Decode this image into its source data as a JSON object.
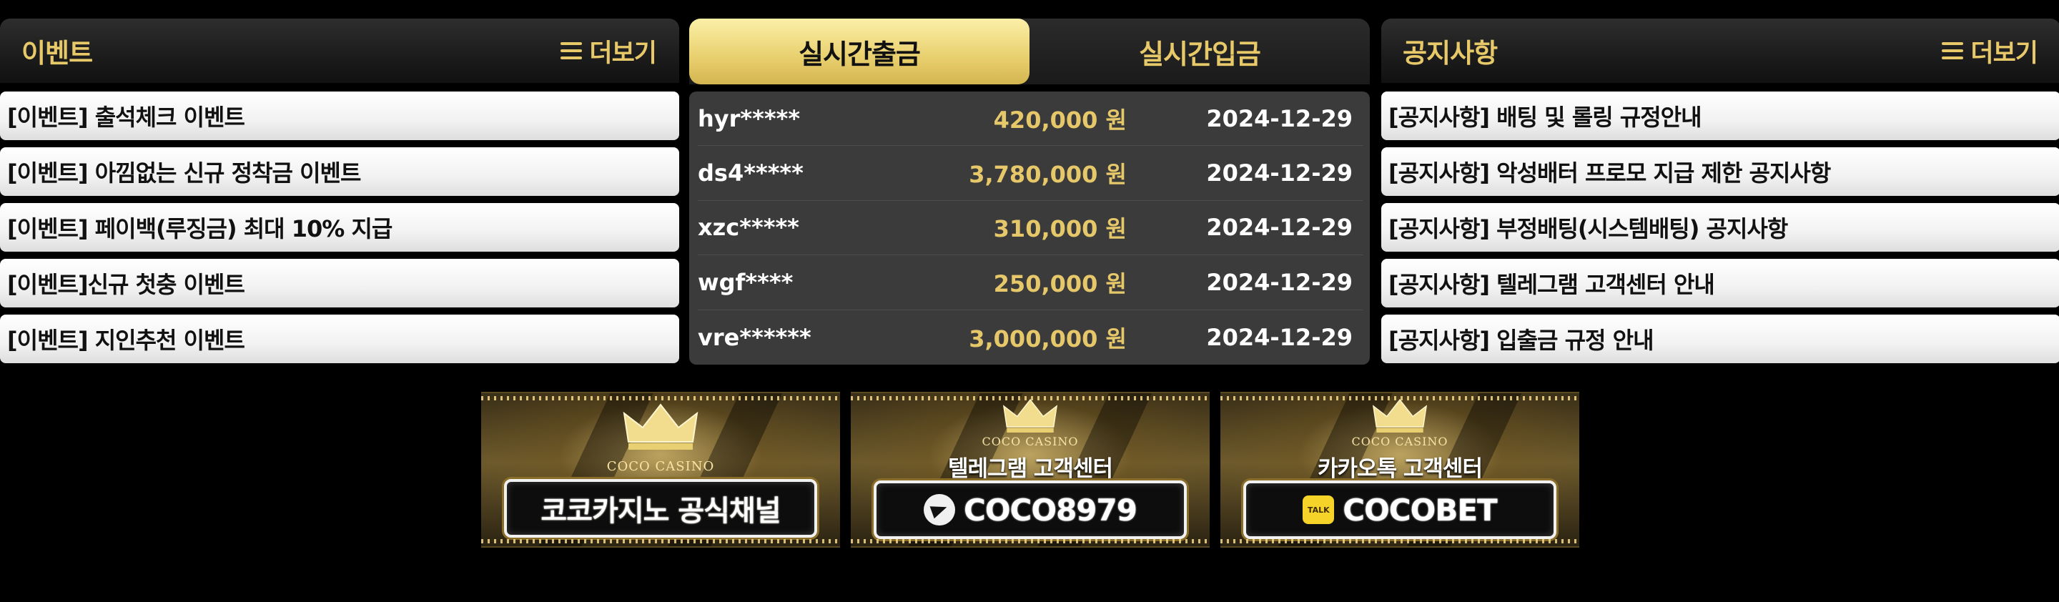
{
  "events": {
    "title": "이벤트",
    "more_label": "더보기",
    "items": [
      "[이벤트] 출석체크 이벤트",
      "[이벤트] 아낌없는 신규 정착금 이벤트",
      "[이벤트] 페이백(루징금) 최대 10% 지급",
      "[이벤트]신규 첫충 이벤트",
      "[이벤트] 지인추천 이벤트"
    ]
  },
  "live": {
    "tab_withdraw": "실시간출금",
    "tab_deposit": "실시간입금",
    "active_tab": "실시간출금",
    "rows": [
      {
        "user": "hyr*****",
        "amount": "420,000 원",
        "date": "2024-12-29"
      },
      {
        "user": "ds4*****",
        "amount": "3,780,000 원",
        "date": "2024-12-29"
      },
      {
        "user": "xzc*****",
        "amount": "310,000 원",
        "date": "2024-12-29"
      },
      {
        "user": "wgf****",
        "amount": "250,000 원",
        "date": "2024-12-29"
      },
      {
        "user": "vre******",
        "amount": "3,000,000 원",
        "date": "2024-12-29"
      }
    ]
  },
  "notices": {
    "title": "공지사항",
    "more_label": "더보기",
    "items": [
      "[공지사항] 배팅 및 롤링 규정안내",
      "[공지사항] 악성배터 프로모 지급 제한 공지사항",
      "[공지사항] 부정배팅(시스템배팅) 공지사항",
      "[공지사항] 텔레그램 고객센터 안내",
      "[공지사항] 입출금 규정 안내"
    ]
  },
  "banners": {
    "official": {
      "brand": "COCO CASINO",
      "label": "코코카지노 공식채널"
    },
    "telegram": {
      "brand": "COCO CASINO",
      "caption": "텔레그램 고객센터",
      "id": "COCO8979",
      "icon": "telegram-icon"
    },
    "kakao": {
      "brand": "COCO CASINO",
      "caption": "카카오톡 고객센터",
      "id": "COCOBET",
      "icon": "kakaotalk-icon",
      "icon_text": "TALK"
    }
  },
  "colors": {
    "gold": "#e7c96a",
    "background": "#000000",
    "table_bg": "#3b3b3b"
  }
}
